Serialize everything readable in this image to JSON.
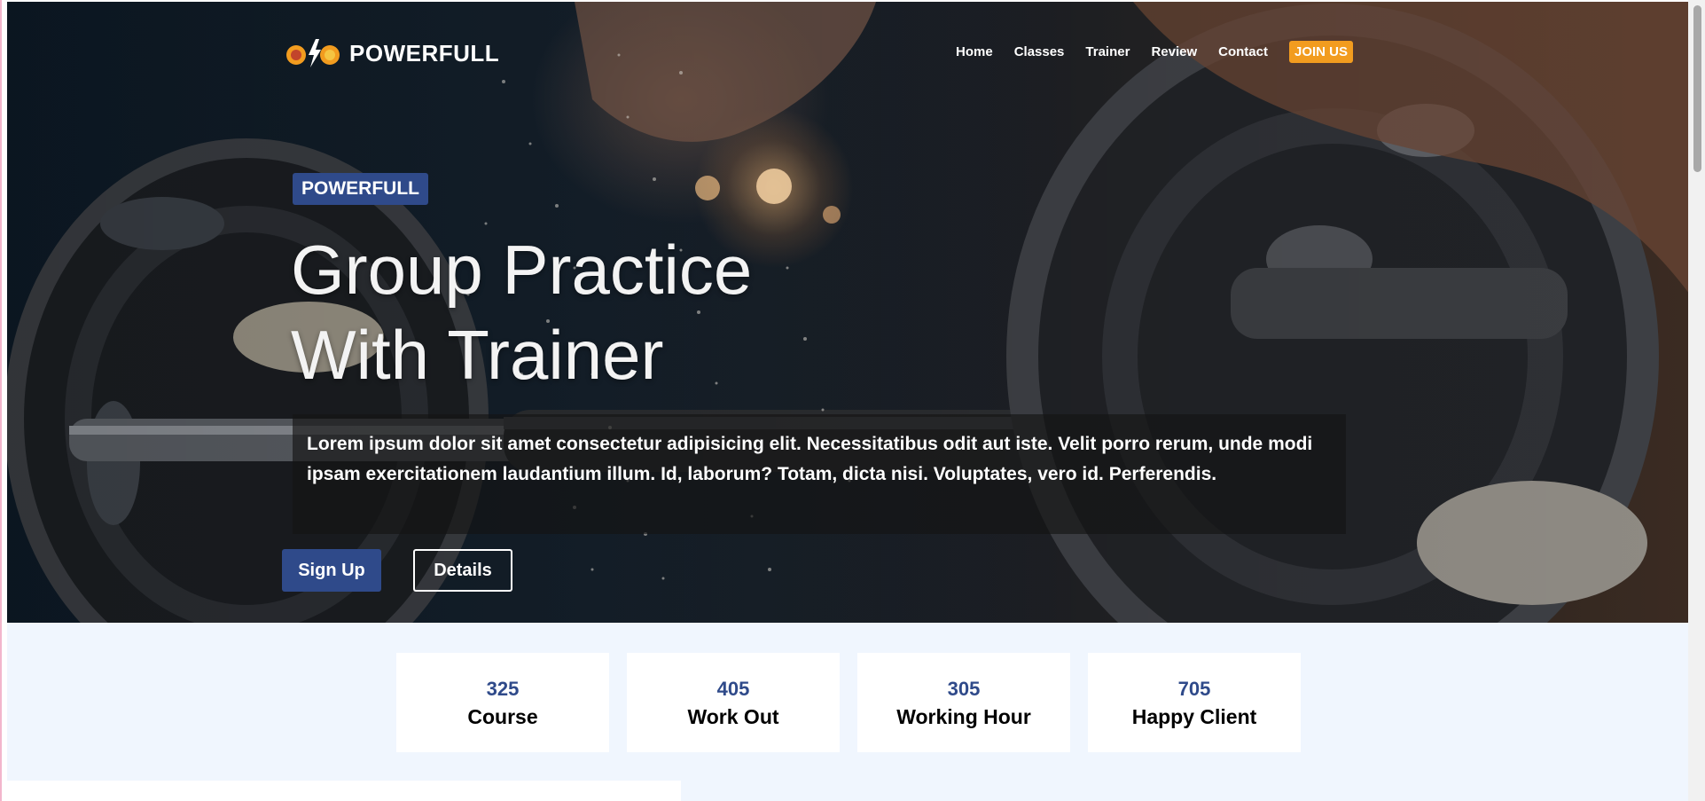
{
  "brand": {
    "name": "POWERFULL",
    "accent": "#2f4a8a",
    "join_color": "#f29c1f"
  },
  "nav": {
    "items": [
      {
        "label": "Home"
      },
      {
        "label": "Classes"
      },
      {
        "label": "Trainer"
      },
      {
        "label": "Review"
      },
      {
        "label": "Contact"
      }
    ],
    "join_label": "JOIN US"
  },
  "hero": {
    "badge": "POWERFULL",
    "headline_line1": "Group Practice",
    "headline_line2": "With Trainer",
    "description": "Lorem ipsum dolor sit amet consectetur adipisicing elit. Necessitatibus odit aut iste. Velit porro rerum, unde modi ipsam exercitationem laudantium illum. Id, laborum? Totam, dicta nisi. Voluptates, vero id. Perferendis.",
    "signup_label": "Sign Up",
    "details_label": "Details"
  },
  "stats": [
    {
      "value": "325",
      "label": "Course"
    },
    {
      "value": "405",
      "label": "Work Out"
    },
    {
      "value": "305",
      "label": "Working Hour"
    },
    {
      "value": "705",
      "label": "Happy Client"
    }
  ]
}
